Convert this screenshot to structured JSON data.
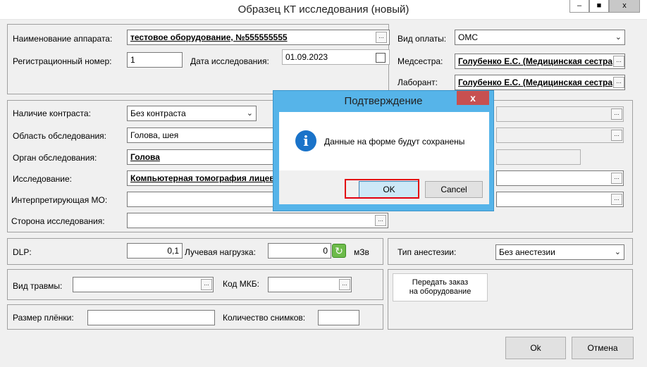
{
  "window": {
    "title": "Образец КТ исследования (новый)",
    "minimize": "–",
    "restore": "■",
    "close": "x"
  },
  "device": {
    "label": "Наименование аппарата:",
    "value": "тестовое оборудование, №555555555",
    "reg_label": "Регистрационный номер:",
    "reg_value": "1",
    "date_label": "Дата исследования:",
    "date_value": "01.09.2023"
  },
  "payment": {
    "label": "Вид оплаты:",
    "value": "ОМС",
    "nurse_label": "Медсестра:",
    "nurse_value": "Голубенко Е.С. (Медицинская сестра",
    "lab_label": "Лаборант:",
    "lab_value": "Голубенко Е.С. (Медицинская сестра"
  },
  "study": {
    "contrast_label": "Наличие контраста:",
    "contrast_value": "Без контраста",
    "area_label": "Область обследования:",
    "area_value": "Голова, шея",
    "organ_label": "Орган обследования:",
    "organ_value": "Голова",
    "study_label": "Исследование:",
    "study_value": "Компьютерная томография лицево",
    "mo_label": "Интерпретирующая МО:",
    "mo_value": "",
    "side_label": "Сторона исследования:",
    "side_value": ""
  },
  "dose": {
    "dlp_label": "DLP:",
    "dlp_value": "0,1",
    "load_label": "Лучевая нагрузка:",
    "load_value": "0",
    "unit": "мЗв"
  },
  "anesthesia": {
    "label": "Тип анестезии:",
    "value": "Без анестезии"
  },
  "trauma": {
    "label": "Вид травмы:",
    "value": "",
    "mkb_label": "Код МКБ:",
    "mkb_value": ""
  },
  "film": {
    "size_label": "Размер плёнки:",
    "size_value": "",
    "count_label": "Количество снимков:",
    "count_value": ""
  },
  "order_button": {
    "line1": "Передать заказ",
    "line2": "на оборудование"
  },
  "footer": {
    "ok": "Ok",
    "cancel": "Отмена"
  },
  "dialog": {
    "title": "Подтверждение",
    "close": "x",
    "message": "Данные на форме будут сохранены",
    "ok": "OK",
    "cancel": "Cancel",
    "icon": "info-icon"
  },
  "icons": {
    "dots": "...",
    "dropdown": "⌄",
    "refresh": "↻"
  },
  "colors": {
    "dialog_frame": "#56b4e9",
    "highlight": "#e3000f",
    "dialog_close": "#c75050"
  }
}
